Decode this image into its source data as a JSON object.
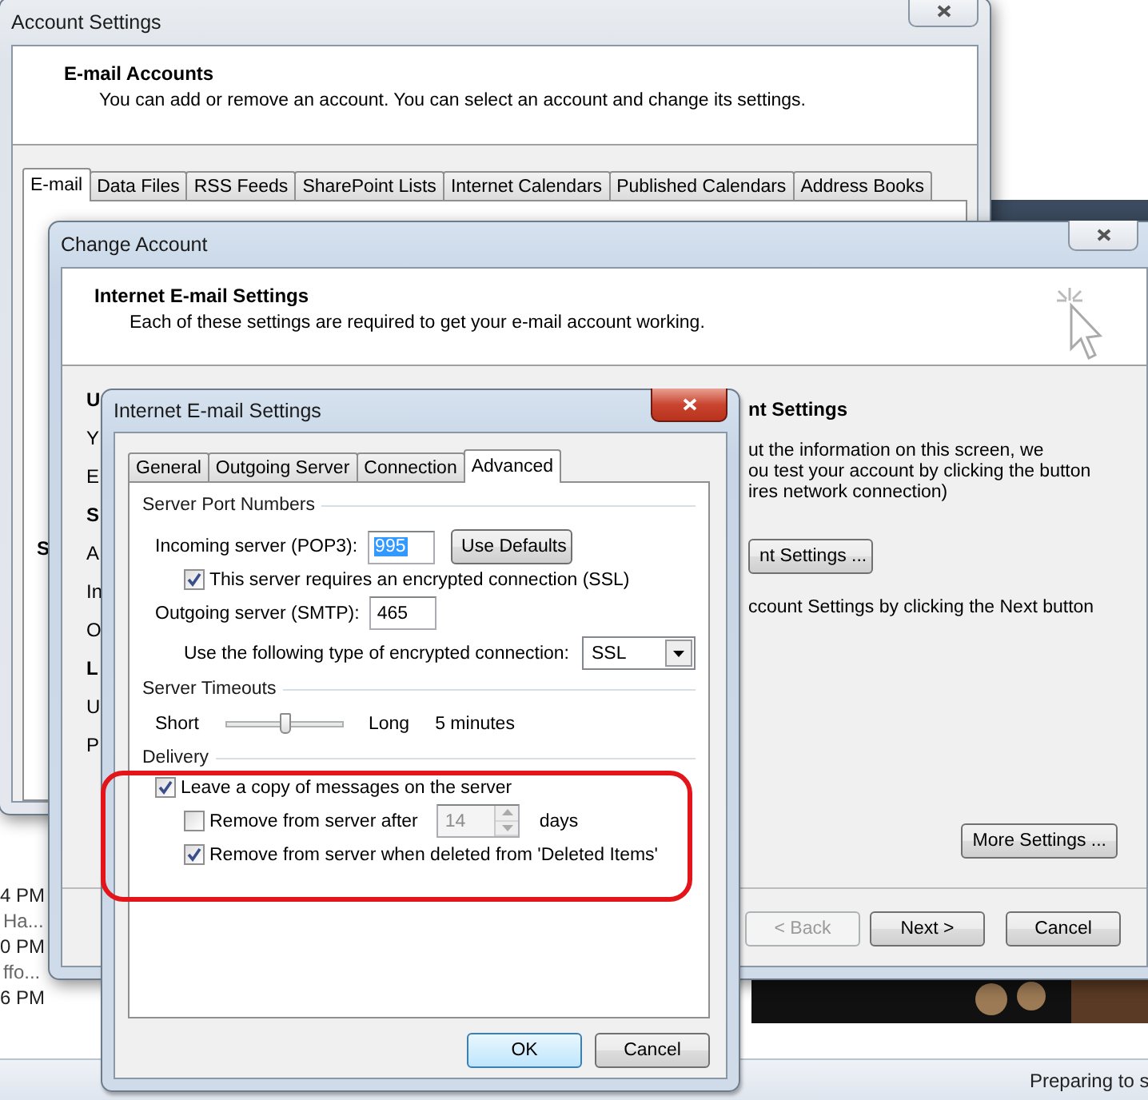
{
  "inbox_fragments": [
    {
      "time": "4 PM",
      "preview": "Ha..."
    },
    {
      "time": "0 PM",
      "preview": "ffo..."
    },
    {
      "time": "6 PM"
    }
  ],
  "account_settings": {
    "title": "Account Settings",
    "heading": "E-mail Accounts",
    "description": "You can add or remove an account. You can select an account and change its settings.",
    "tabs": [
      {
        "label": "E-mail",
        "selected": true
      },
      {
        "label": "Data Files",
        "selected": false
      },
      {
        "label": "RSS Feeds",
        "selected": false
      },
      {
        "label": "SharePoint Lists",
        "selected": false
      },
      {
        "label": "Internet Calendars",
        "selected": false
      },
      {
        "label": "Published Calendars",
        "selected": false
      },
      {
        "label": "Address Books",
        "selected": false
      }
    ],
    "side_fragment": "S"
  },
  "change_account": {
    "title": "Change Account",
    "heading": "Internet E-mail Settings",
    "description": "Each of these settings are required to get your e-mail account working.",
    "left_fragments": [
      {
        "text": "U",
        "bold": true
      },
      {
        "text": "Y",
        "bold": false
      },
      {
        "text": "E",
        "bold": false
      },
      {
        "text": "S",
        "bold": true
      },
      {
        "text": "A",
        "bold": false
      },
      {
        "text": "In",
        "bold": false
      },
      {
        "text": "O",
        "bold": false
      },
      {
        "text": "L",
        "bold": true
      },
      {
        "text": "U",
        "bold": false
      },
      {
        "text": "P",
        "bold": false
      }
    ],
    "right_heading": "nt Settings",
    "right_lines": [
      "ut the information on this screen, we",
      "ou test your account by clicking the button",
      "ires network connection)"
    ],
    "test_button": "nt Settings ...",
    "next_hint": "ccount Settings by clicking the Next button",
    "more_settings": "More Settings ...",
    "buttons": [
      {
        "label": "< Back",
        "disabled": true
      },
      {
        "label": "Next >",
        "disabled": false
      },
      {
        "label": "Cancel",
        "disabled": false
      }
    ]
  },
  "dialog": {
    "title": "Internet E-mail Settings",
    "tabs": [
      {
        "label": "General",
        "selected": false
      },
      {
        "label": "Outgoing Server",
        "selected": false
      },
      {
        "label": "Connection",
        "selected": false
      },
      {
        "label": "Advanced",
        "selected": true
      }
    ],
    "port_group": "Server Port Numbers",
    "incoming_label": "Incoming server (POP3):",
    "incoming_value": "995",
    "use_defaults": "Use Defaults",
    "ssl_check": {
      "label": "This server requires an encrypted connection (SSL)",
      "checked": true
    },
    "outgoing_label": "Outgoing server (SMTP):",
    "outgoing_value": "465",
    "encryption_label": "Use the following type of encrypted connection:",
    "encryption_value": "SSL",
    "timeout_group": "Server Timeouts",
    "timeout_short": "Short",
    "timeout_slider": {
      "level": 0.5
    },
    "timeout_long": "Long",
    "timeout_value": "5 minutes",
    "delivery_group": "Delivery",
    "leave_copy": {
      "label": "Leave a copy of messages on the server",
      "checked": true
    },
    "remove_after": {
      "label": "Remove from server after",
      "checked": false,
      "days_value": "14",
      "days_disabled": true,
      "unit": "days"
    },
    "remove_deleted": {
      "label": "Remove from server when deleted from 'Deleted Items'",
      "checked": true
    },
    "buttons": [
      {
        "label": "OK",
        "default": true
      },
      {
        "label": "Cancel",
        "default": false
      }
    ]
  },
  "status_bar": "Preparing to s"
}
